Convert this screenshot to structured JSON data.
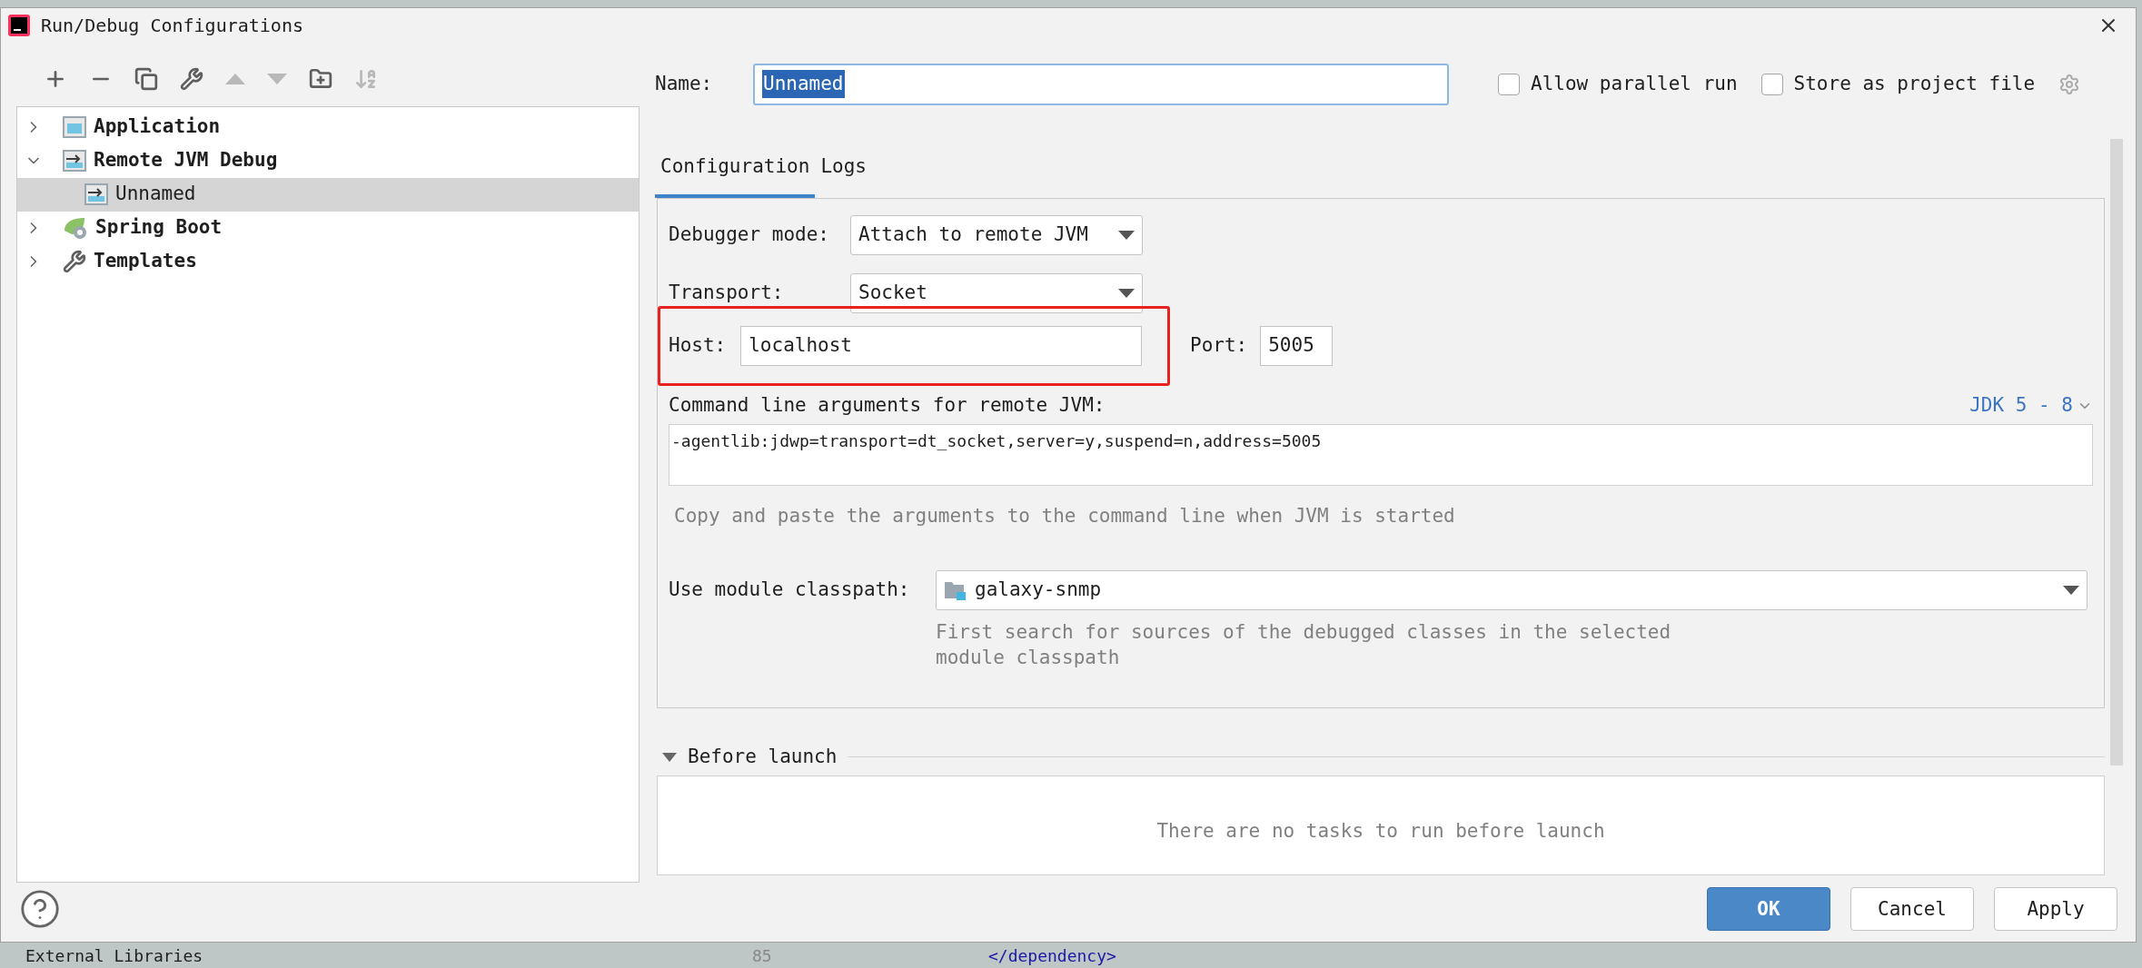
{
  "window": {
    "title": "Run/Debug Configurations"
  },
  "toolbar": [
    {
      "kind": "add",
      "disabled": false
    },
    {
      "kind": "remove",
      "disabled": false
    },
    {
      "kind": "copy",
      "disabled": false
    },
    {
      "kind": "wrench",
      "disabled": false
    },
    {
      "kind": "up",
      "disabled": true
    },
    {
      "kind": "down",
      "disabled": true
    },
    {
      "kind": "folder",
      "disabled": false
    },
    {
      "kind": "sort",
      "disabled": true
    }
  ],
  "tree": [
    {
      "label": "Application",
      "kind": "application",
      "expanded": false,
      "selected": false
    },
    {
      "label": "Remote JVM Debug",
      "kind": "remote",
      "expanded": true,
      "selected": false,
      "children": [
        {
          "label": "Unnamed",
          "kind": "remote",
          "selected": true
        }
      ]
    },
    {
      "label": "Spring Boot",
      "kind": "spring",
      "expanded": false,
      "selected": false
    },
    {
      "label": "Templates",
      "kind": "wrench",
      "expanded": false,
      "selected": false
    }
  ],
  "name_field": {
    "label": "Name:",
    "value": "Unnamed"
  },
  "options": [
    {
      "label": "Allow parallel run",
      "checked": false
    },
    {
      "label": "Store as project file",
      "checked": false
    }
  ],
  "tabs": [
    {
      "label": "Configuration",
      "selected": true
    },
    {
      "label": "Logs",
      "selected": false
    }
  ],
  "debugger_mode": {
    "label": "Debugger mode:",
    "value": "Attach to remote JVM"
  },
  "transport": {
    "label": "Transport:",
    "value": "Socket"
  },
  "host": {
    "label": "Host:",
    "value": "localhost"
  },
  "port": {
    "label": "Port:",
    "value": "5005"
  },
  "command_line": {
    "label": "Command line arguments for remote JVM:",
    "jdk_link": "JDK 5 - 8",
    "value": "-agentlib:jdwp=transport=dt_socket,server=y,suspend=n,address=5005",
    "hint": "Copy and paste the arguments to the command line when JVM is started"
  },
  "module_classpath": {
    "label": "Use module classpath:",
    "value": "galaxy-snmp",
    "hint": "First search for sources of the debugged classes in the selected module classpath"
  },
  "before_launch": {
    "title": "Before launch",
    "expanded": true,
    "empty_message": "There are no tasks to run before launch"
  },
  "buttons": [
    {
      "label": "OK",
      "primary": true
    },
    {
      "label": "Cancel",
      "primary": false
    },
    {
      "label": "Apply",
      "primary": false
    }
  ],
  "background_editor": {
    "tree_item": "External Libraries",
    "line_number": "85",
    "code": "</dependency>"
  }
}
